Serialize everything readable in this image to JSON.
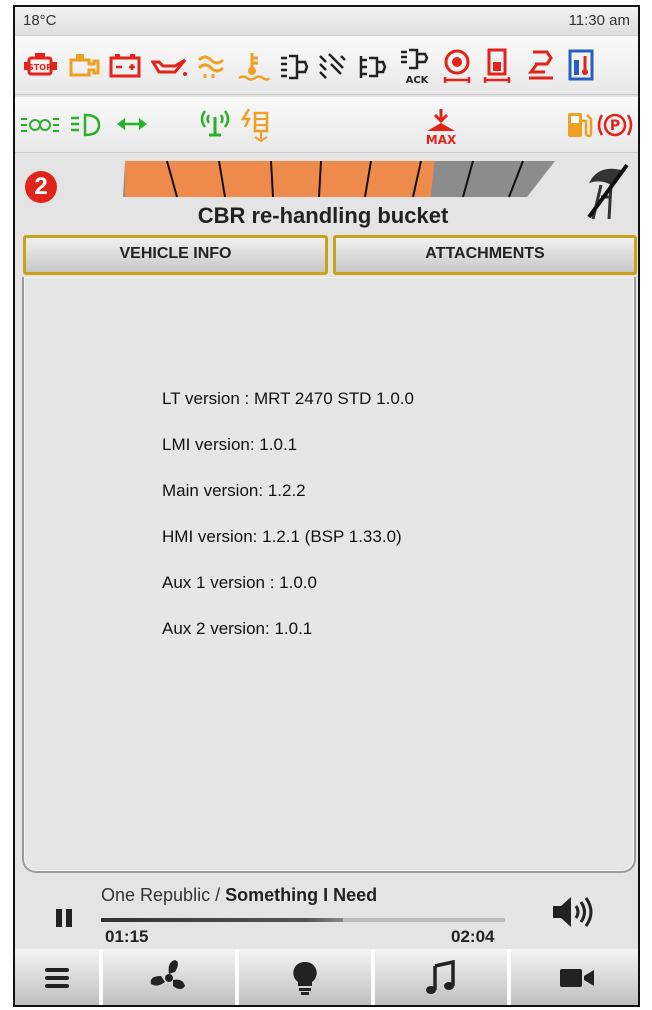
{
  "status": {
    "temperature": "18°C",
    "time": "11:30 am"
  },
  "warning_icons_row1": [
    "engine-stop-icon",
    "engine-warning-icon",
    "battery-icon",
    "oil-pressure-icon",
    "preheat-icon",
    "coolant-temp-icon",
    "air-filter-icon",
    "hydraulic-filter-icon",
    "transmission-filter-icon",
    "ack-filter-icon",
    "brake-fluid-icon",
    "hydraulic-oil-icon",
    "transmission-temp-icon",
    "fluid-level-icon"
  ],
  "warning_icons_row2": [
    "parking-lights-icon",
    "low-beam-icon",
    "turn-signal-icon",
    "antenna-icon",
    "electric-overload-icon",
    "max-load-icon",
    "fuel-icon",
    "parking-brake-icon"
  ],
  "warning_labels": {
    "ack": "ACK",
    "max": "MAX"
  },
  "colors": {
    "warn_red": "#e2231a",
    "warn_orange": "#f0a020",
    "ok_green": "#29b029",
    "info_blue": "#2560c0",
    "gauge_orange": "#ee8a4c",
    "tab_border": "#c9a21a"
  },
  "attachment": {
    "number": "2",
    "name": "CBR re-handling bucket",
    "load_gauge_fraction": 0.72
  },
  "tabs": {
    "vehicle_info": "VEHICLE INFO",
    "attachments": "ATTACHMENTS"
  },
  "versions": [
    "LT version : MRT 2470 STD 1.0.0",
    "LMI version: 1.0.1",
    "Main version: 1.2.2",
    "HMI version: 1.2.1 (BSP 1.33.0)",
    "Aux 1 version : 1.0.0",
    "Aux 2 version: 1.0.1"
  ],
  "player": {
    "artist": "One Republic",
    "separator": " / ",
    "song": "Something I Need",
    "current": "01:15",
    "total": "02:04",
    "progress_fraction": 0.6
  },
  "nav": [
    "menu-icon",
    "fan-icon",
    "lightbulb-icon",
    "music-icon",
    "camera-icon"
  ]
}
